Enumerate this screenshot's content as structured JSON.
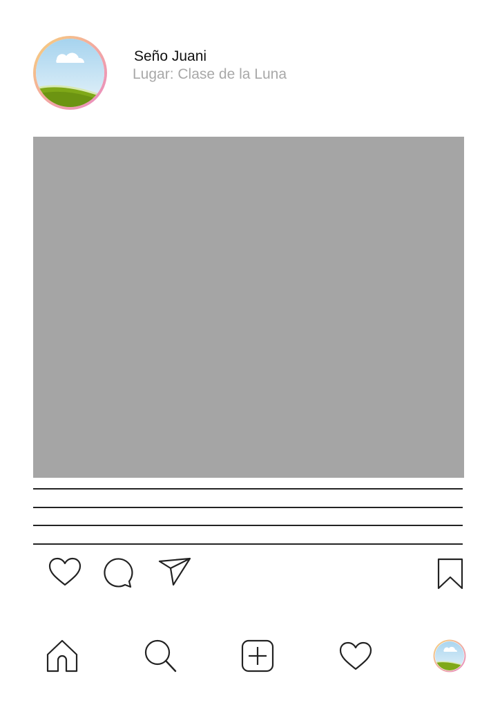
{
  "post": {
    "username": "Seño Juani",
    "location": "Lugar: Clase de la Luna",
    "caption_lines": 4
  },
  "actions": {
    "left": [
      "heart-icon",
      "comment-icon",
      "send-icon"
    ],
    "right": [
      "bookmark-icon"
    ]
  },
  "bottom_nav": [
    "home-icon",
    "search-icon",
    "add-icon",
    "heart-icon",
    "profile-avatar"
  ],
  "colors": {
    "photo_placeholder": "#a5a5a5",
    "location_text": "#a8a8a8",
    "sky": "#b9dcef",
    "hill": "#7fa818"
  }
}
